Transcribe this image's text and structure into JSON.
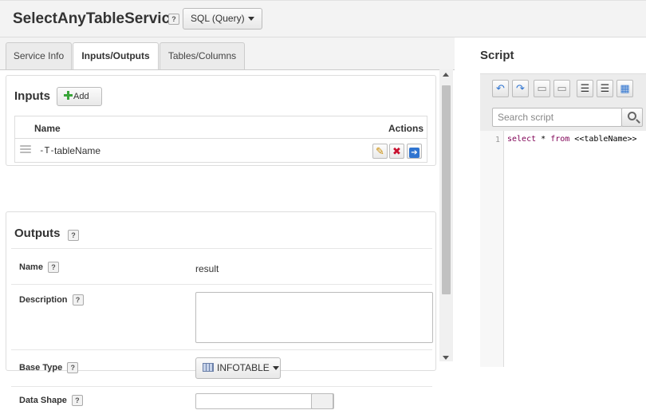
{
  "service": {
    "name": "SelectAnyTableService",
    "help": "?",
    "handler_label": "SQL (Query)"
  },
  "tabs": [
    {
      "label": "Service Info"
    },
    {
      "label": "Inputs/Outputs"
    },
    {
      "label": "Tables/Columns"
    }
  ],
  "inputs": {
    "title": "Inputs",
    "add_label": "Add",
    "columns": {
      "name": "Name",
      "actions": "Actions"
    },
    "rows": [
      {
        "type_glyph": "-T-",
        "name": "tableName"
      }
    ]
  },
  "outputs": {
    "title": "Outputs",
    "help": "?",
    "fields": {
      "name": {
        "label": "Name",
        "value": "result"
      },
      "description": {
        "label": "Description",
        "value": ""
      },
      "base_type": {
        "label": "Base Type",
        "value": "INFOTABLE"
      },
      "data_shape": {
        "label": "Data Shape",
        "value": ""
      }
    }
  },
  "script": {
    "title": "Script",
    "search_placeholder": "Search script",
    "toolbar": [
      "undo-icon",
      "redo-icon",
      "add-bookmark-icon",
      "remove-bookmark-icon",
      "align-left-icon",
      "align-center-icon",
      "format-code-icon"
    ],
    "lines": [
      {
        "no": "1",
        "kw1": "select",
        "mid": " * ",
        "kw2": "from",
        "rest": " <<tableName>>"
      }
    ]
  },
  "colors": {
    "accent_blue": "#2f74d0",
    "delete_red": "#c8102e",
    "add_green": "#3aa53a"
  }
}
